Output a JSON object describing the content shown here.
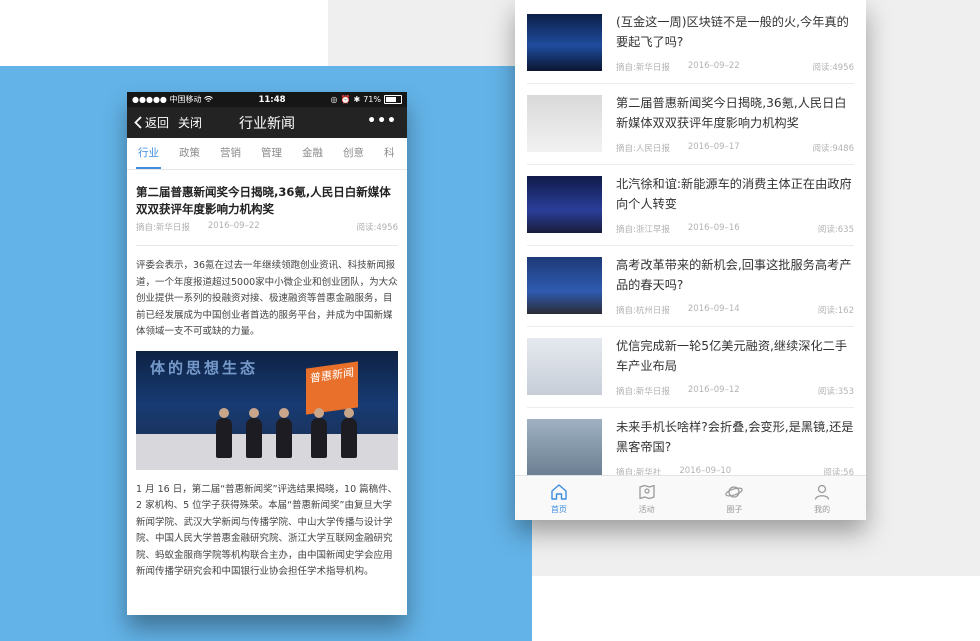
{
  "left_phone": {
    "status": {
      "carrier": "●●●●● 中国移动",
      "time": "11:48",
      "battery": "71%"
    },
    "nav": {
      "back_label": "返回",
      "close_label": "关闭",
      "title": "行业新闻",
      "more_label": "•••"
    },
    "tabs": [
      "行业",
      "政策",
      "营销",
      "管理",
      "金融",
      "创意",
      "科"
    ],
    "article": {
      "title": "第二届普惠新闻奖今日揭晓,36氪,人民日白新媒体双双获评年度影响力机构奖",
      "source": "摘自:新华日报",
      "date": "2016–09–22",
      "views": "阅读:4956",
      "paragraph1": "评委会表示，36氪在过去一年继续领跑创业资讯、科技新闻报道，一个年度报道超过5000家中小微企业和创业团队，为大众创业提供一系列的投融资对接、极速融资等普惠金融服务，目前已经发展成为中国创业者首选的服务平台，并成为中国新媒体领域一支不可或缺的力量。",
      "photo_banner": "体的思想生态",
      "photo_logo": "普惠新闻",
      "paragraph2": "1 月 16 日，第二届“普惠新闻奖”评选结果揭晓，10 篇稿件、2 家机构、5 位学子获得殊荣。本届“普惠新闻奖”由复旦大学新闻学院、武汉大学新闻与传播学院、中山大学传播与设计学院、中国人民大学普惠金融研究院、浙江大学互联网金融研究院、蚂蚁金服商学院等机构联合主办，由中国新闻史学会应用新闻传播学研究会和中国银行业协会担任学术指导机构。"
    }
  },
  "right_phone": {
    "feed": [
      {
        "title": "(互金这一周)区块链不是一般的火,今年真的要起飞了吗?",
        "source": "摘自:新华日报",
        "date": "2016–09–22",
        "views": "阅读:4956"
      },
      {
        "title": "第二届普惠新闻奖今日揭晓,36氪,人民日白新媒体双双获评年度影响力机构奖",
        "source": "摘自:人民日报",
        "date": "2016–09–17",
        "views": "阅读:9486"
      },
      {
        "title": "北汽徐和谊:新能源车的消费主体正在由政府向个人转变",
        "source": "摘自:浙江早报",
        "date": "2016–09–16",
        "views": "阅读:635"
      },
      {
        "title": "高考改革带来的新机会,回事这批服务高考产品的春天吗?",
        "source": "摘自:杭州日报",
        "date": "2016–09–14",
        "views": "阅读:162"
      },
      {
        "title": "优信完成新一轮5亿美元融资,继续深化二手车产业布局",
        "source": "摘自:新华日报",
        "date": "2016–09–12",
        "views": "阅读:353"
      },
      {
        "title": "未来手机长啥样?会折叠,会变形,是黑镜,还是黑客帝国?",
        "source": "摘自:新华社",
        "date": "2016–09–10",
        "views": "阅读:56"
      }
    ],
    "tabbar": [
      {
        "label": "首页",
        "icon": "home-icon"
      },
      {
        "label": "活动",
        "icon": "map-icon"
      },
      {
        "label": "圈子",
        "icon": "planet-icon"
      },
      {
        "label": "我的",
        "icon": "user-icon"
      }
    ]
  },
  "colors": {
    "accent": "#3d8ee0",
    "background_blue": "#63b3e8",
    "background_gray": "#efefef",
    "dark_bar": "#232323"
  }
}
